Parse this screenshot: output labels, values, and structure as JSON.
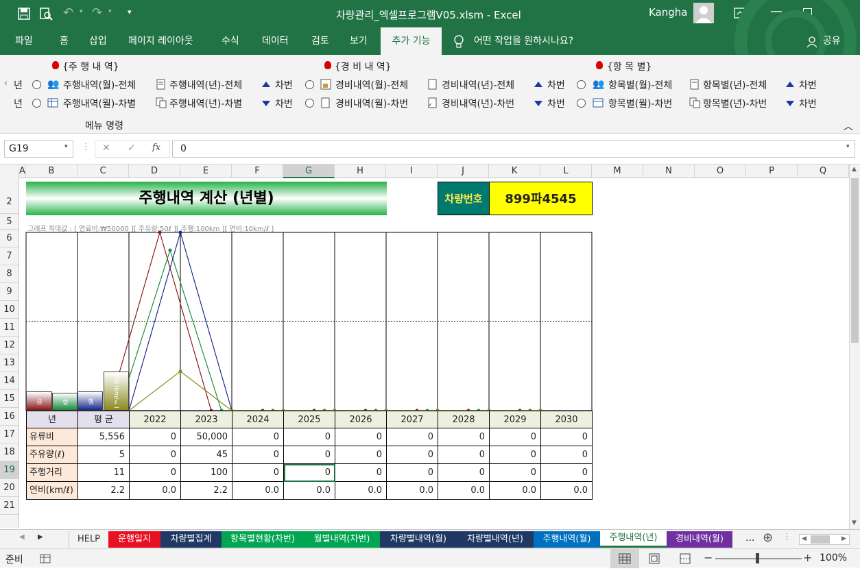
{
  "window": {
    "title": "차량관리_엑셀프로그램V05.xlsm  -  Excel",
    "user": "Kangha"
  },
  "tabs": [
    "파일",
    "홈",
    "삽입",
    "페이지 레이아웃",
    "수식",
    "데이터",
    "검토",
    "보기",
    "추가 기능"
  ],
  "tell_me": "어떤 작업을 원하시나요?",
  "share": "공유",
  "ribbon": {
    "groups": [
      "{주 행 내 역}",
      "{경 비 내 역}",
      "{항 목 별}"
    ],
    "row1": [
      "주행내역(월)-전체",
      "주행내역(년)-전체",
      "차번",
      "경비내역(월)-전체",
      "경비내역(년)-전체",
      "차번",
      "항목별(월)-전체",
      "항목별(년)-전체",
      "차번"
    ],
    "row2": [
      "주행내역(월)-차별",
      "주행내역(년)-차별",
      "차번",
      "경비내역(월)-차번",
      "경비내역(년)-차번",
      "차번",
      "항목별(월)-차번",
      "항목별(년)-차번",
      "차번"
    ],
    "left_cut": "년",
    "group_label": "메뉴 명령"
  },
  "formula_bar": {
    "name_box": "G19",
    "value": "0",
    "fx": "fx"
  },
  "columns": [
    "A",
    "B",
    "C",
    "D",
    "E",
    "F",
    "G",
    "H",
    "I",
    "J",
    "K",
    "L",
    "M",
    "N",
    "O",
    "P",
    "Q"
  ],
  "rows": [
    "2",
    "5",
    "6",
    "7",
    "8",
    "9",
    "10",
    "11",
    "12",
    "13",
    "14",
    "15",
    "16",
    "17",
    "18",
    "19",
    "20",
    "21"
  ],
  "sheet": {
    "title": "주행내역 계산 (년별)",
    "car_label": "차량번호",
    "car_number": "899파4545",
    "graph_note": "그래프 최대값 : [ 연료비:₩50000 ][ 주유량:50ℓ ][ 주행:100km ][ 연비:10km/ℓ ]",
    "legend_bars": [
      "금",
      "량",
      "행",
      "연비(km/ℓ)"
    ],
    "header": {
      "year": "년",
      "avg": "평 균"
    },
    "years": [
      "2022",
      "2023",
      "2024",
      "2025",
      "2026",
      "2027",
      "2028",
      "2029",
      "2030"
    ],
    "table": [
      {
        "label": "유류비",
        "avg": "5,556",
        "values": [
          "0",
          "50,000",
          "0",
          "0",
          "0",
          "0",
          "0",
          "0",
          "0"
        ]
      },
      {
        "label": "주유량(ℓ)",
        "avg": "5",
        "values": [
          "0",
          "45",
          "0",
          "0",
          "0",
          "0",
          "0",
          "0",
          "0"
        ]
      },
      {
        "label": "주행거리",
        "avg": "11",
        "values": [
          "0",
          "100",
          "0",
          "0",
          "0",
          "0",
          "0",
          "0",
          "0"
        ]
      },
      {
        "label": "연비(km/ℓ)",
        "avg": "2.2",
        "values": [
          "0.0",
          "2.2",
          "0.0",
          "0.0",
          "0.0",
          "0.0",
          "0.0",
          "0.0",
          "0.0"
        ]
      }
    ]
  },
  "sheet_tabs": [
    {
      "label": "HELP",
      "color": "#f3f3f3"
    },
    {
      "label": "운행일지",
      "color": "#e81123"
    },
    {
      "label": "차량별집계",
      "color": "#1f3864"
    },
    {
      "label": "항목별현황(차번)",
      "color": "#00a651"
    },
    {
      "label": "월별내역(차번)",
      "color": "#00a651"
    },
    {
      "label": "차량별내역(월)",
      "color": "#1f3864"
    },
    {
      "label": "차량별내역(년)",
      "color": "#1f3864"
    },
    {
      "label": "주행내역(월)",
      "color": "#0070c0"
    },
    {
      "label": "주행내역(년)",
      "color": "#ffffff"
    },
    {
      "label": "경비내역(월)",
      "color": "#7030a0"
    }
  ],
  "sheet_more": "...",
  "status": {
    "ready": "준비",
    "zoom": "100%"
  },
  "colors": {
    "excel_green": "#217346",
    "fuel": "#8b1a1a",
    "oil": "#1e8a3c",
    "drive": "#1a2a8a",
    "eff": "#8a8a1e"
  }
}
